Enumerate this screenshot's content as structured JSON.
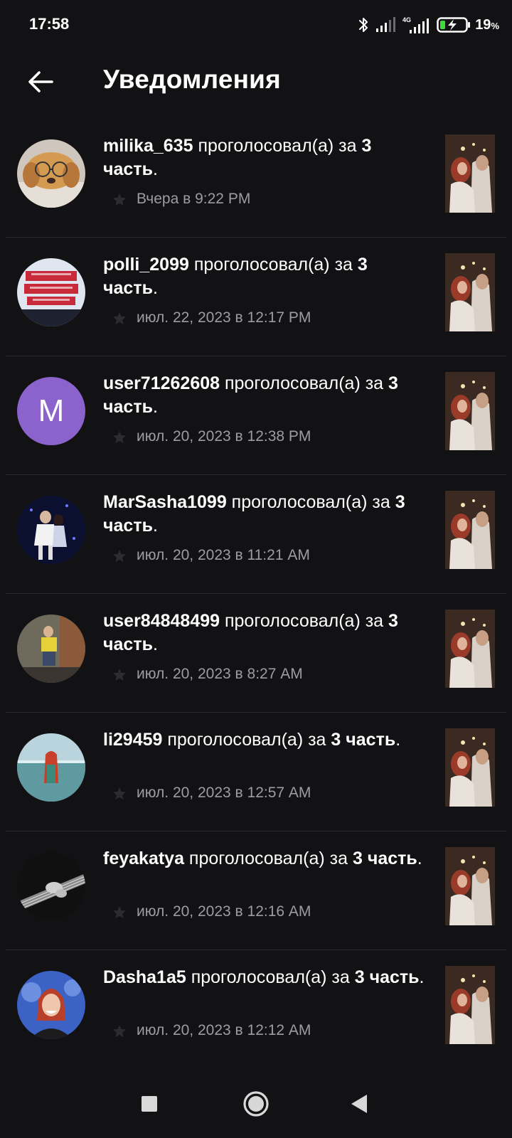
{
  "status_bar": {
    "time": "17:58",
    "battery_percent": "19",
    "battery_unit": "%",
    "network_label": "4G",
    "icons": [
      "bluetooth-icon",
      "signal-icon",
      "signal-4g-icon",
      "battery-charging-icon"
    ]
  },
  "header": {
    "title": "Уведомления",
    "back_icon": "arrow-left-icon"
  },
  "notifications": [
    {
      "user": "milika_635",
      "action": " проголосовал(а) за ",
      "part_number": "3",
      "part_word": "часть",
      "end": ".",
      "timestamp": "Вчера в 9:22 PM",
      "avatar": "photo"
    },
    {
      "user": "polli_2099",
      "action": " проголосовал(а) за ",
      "part_number": "3",
      "part_word": "часть",
      "end": ".",
      "timestamp": "июл. 22, 2023 в 12:17 PM",
      "avatar": "photo"
    },
    {
      "user": "user71262608",
      "action": " проголосовал(а) за ",
      "part_number": "3",
      "part_word": "часть",
      "end": ".",
      "timestamp": "июл. 20, 2023 в 12:38 PM",
      "avatar_letter": "M"
    },
    {
      "user": "MarSasha1099",
      "action": " проголосовал(а) за ",
      "part_number": "3",
      "part_word": "часть",
      "end": ".",
      "timestamp": "июл. 20, 2023 в 11:21 AM",
      "avatar": "photo"
    },
    {
      "user": "user84848499",
      "action": " проголосовал(а) за ",
      "part_number": "3",
      "part_word": "часть",
      "end": ".",
      "timestamp": "июл. 20, 2023 в 8:27 AM",
      "avatar": "photo"
    },
    {
      "user": "li29459",
      "action": " проголосовал(а) за ",
      "part_number": "3",
      "part_word": "часть",
      "end": ".",
      "timestamp": "июл. 20, 2023 в 12:57 AM",
      "avatar": "photo"
    },
    {
      "user": "feyakatya",
      "action": " проголосовал(а) за ",
      "part_number": "3",
      "part_word": "часть",
      "end": ".",
      "timestamp": "июл. 20, 2023 в 12:16 AM",
      "avatar": "photo"
    },
    {
      "user": "Dasha1a5",
      "action": " проголосовал(а) за ",
      "part_number": "3",
      "part_word": "часть",
      "end": ".",
      "timestamp": "июл. 20, 2023 в 12:12 AM",
      "avatar": "photo"
    }
  ],
  "colors": {
    "background": "#121114",
    "text_primary": "#ffffff",
    "text_secondary": "#9e9ca3",
    "divider": "#2b2a2f",
    "avatar_letter_bg": "#8c62cc",
    "battery_fill": "#3ddc3a"
  },
  "nav_bar": {
    "icons": [
      "square-recents-icon",
      "circle-home-icon",
      "triangle-back-icon"
    ]
  }
}
